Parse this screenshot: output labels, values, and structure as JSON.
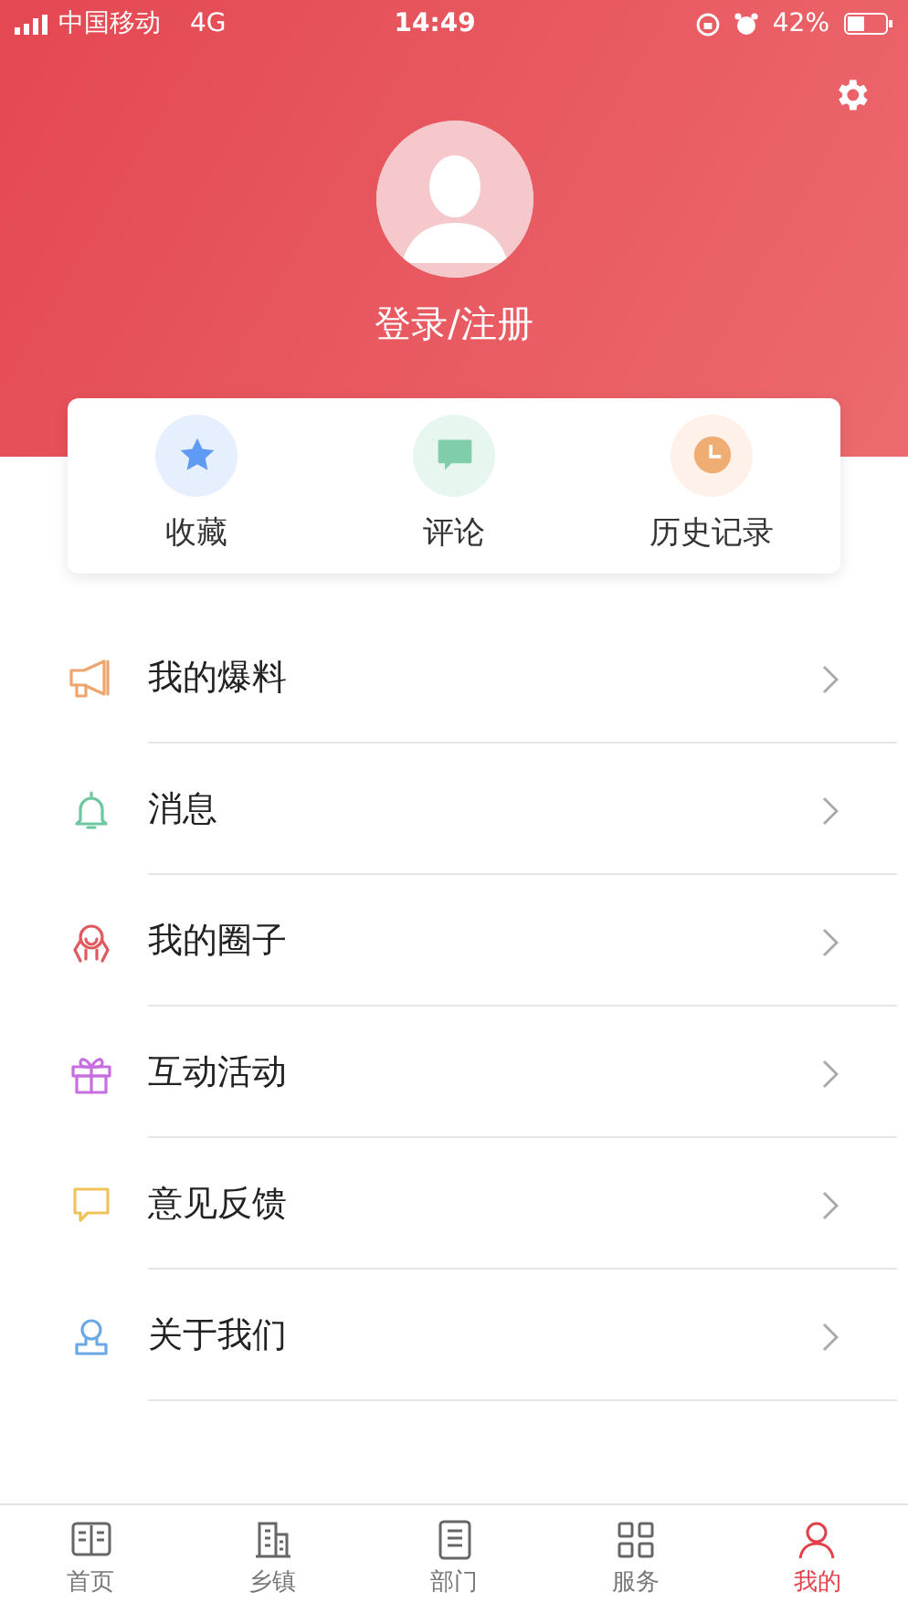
{
  "status_bar": {
    "carrier": "中国移动",
    "network": "4G",
    "time": "14:49",
    "battery": "42%"
  },
  "profile": {
    "login": "登录/注册"
  },
  "quick_actions": [
    {
      "kind": "star",
      "label": "收藏"
    },
    {
      "kind": "comment",
      "label": "评论"
    },
    {
      "kind": "clock",
      "label": "历史记录"
    }
  ],
  "menu": [
    {
      "kind": "megaphone",
      "label": "我的爆料"
    },
    {
      "kind": "bell",
      "label": "消息"
    },
    {
      "kind": "circle",
      "label": "我的圈子"
    },
    {
      "kind": "gift",
      "label": "互动活动"
    },
    {
      "kind": "feedback",
      "label": "意见反馈"
    },
    {
      "kind": "about",
      "label": "关于我们"
    }
  ],
  "tab_bar": [
    {
      "kind": "book",
      "label": "首页",
      "selected": false
    },
    {
      "kind": "town",
      "label": "乡镇",
      "selected": false
    },
    {
      "kind": "dept",
      "label": "部门",
      "selected": false
    },
    {
      "kind": "service",
      "label": "服务",
      "selected": false
    },
    {
      "kind": "me",
      "label": "我的",
      "selected": true
    }
  ]
}
